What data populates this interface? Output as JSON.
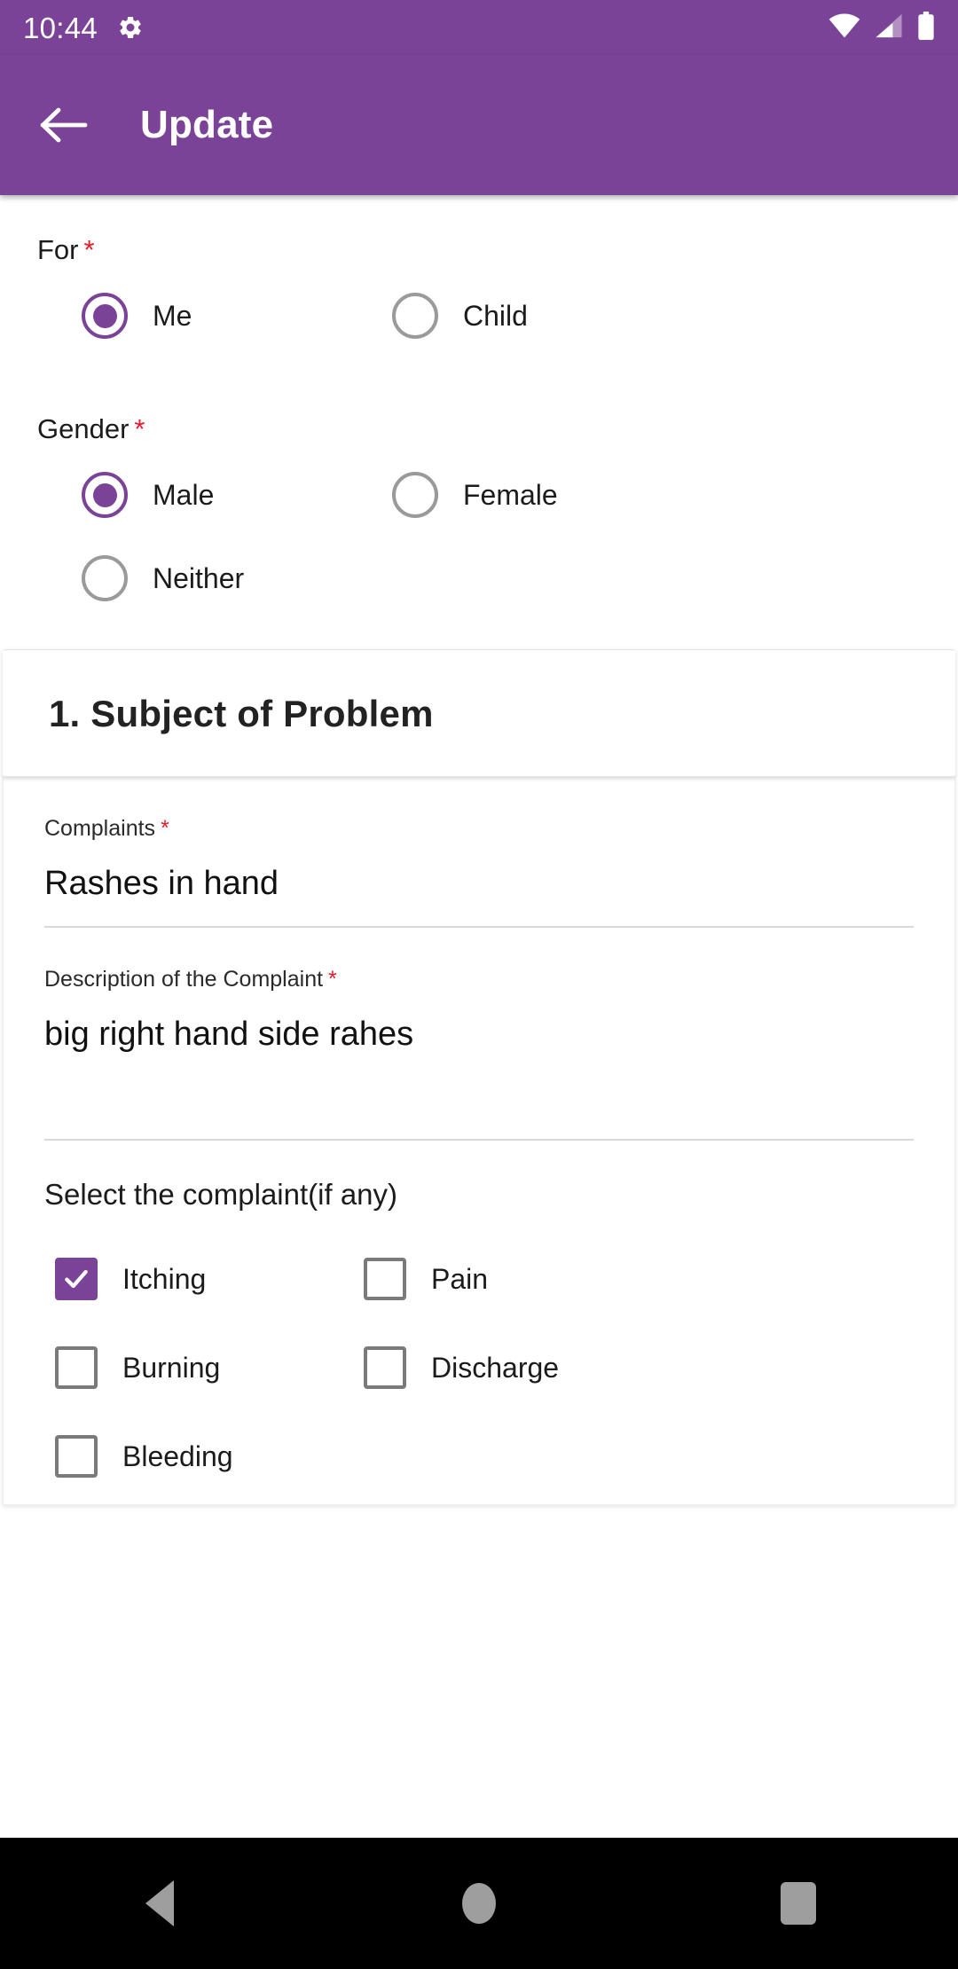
{
  "statusbar": {
    "time": "10:44",
    "gear_icon": "gear-icon",
    "wifi_icon": "wifi-icon",
    "signal_icon": "cellular-signal-icon",
    "battery_icon": "battery-icon"
  },
  "appbar": {
    "back_icon": "arrow-left-icon",
    "title": "Update"
  },
  "form": {
    "for_group": {
      "label": "For",
      "required_mark": "*",
      "options": [
        {
          "label": "Me",
          "selected": true
        },
        {
          "label": "Child",
          "selected": false
        }
      ]
    },
    "gender_group": {
      "label": "Gender",
      "required_mark": "*",
      "options": [
        {
          "label": "Male",
          "selected": true
        },
        {
          "label": "Female",
          "selected": false
        },
        {
          "label": "Neither",
          "selected": false
        }
      ]
    },
    "section": {
      "title": "1. Subject of Problem",
      "complaints": {
        "label": "Complaints",
        "required_mark": "*",
        "value": "Rashes in hand"
      },
      "description": {
        "label": "Description of the Complaint",
        "required_mark": "*",
        "value": "big right hand side rahes"
      },
      "complaint_select": {
        "label": "Select the complaint(if any)",
        "options": [
          {
            "label": "Itching",
            "checked": true
          },
          {
            "label": "Pain",
            "checked": false
          },
          {
            "label": "Burning",
            "checked": false
          },
          {
            "label": "Discharge",
            "checked": false
          },
          {
            "label": "Bleeding",
            "checked": false
          }
        ]
      }
    }
  },
  "navbar": {
    "back_icon": "nav-back-triangle-icon",
    "home_icon": "nav-home-circle-icon",
    "recents_icon": "nav-recents-square-icon"
  },
  "colors": {
    "accent": "#7b4397",
    "required": "#e8192c",
    "navbar_bg": "#000000"
  }
}
